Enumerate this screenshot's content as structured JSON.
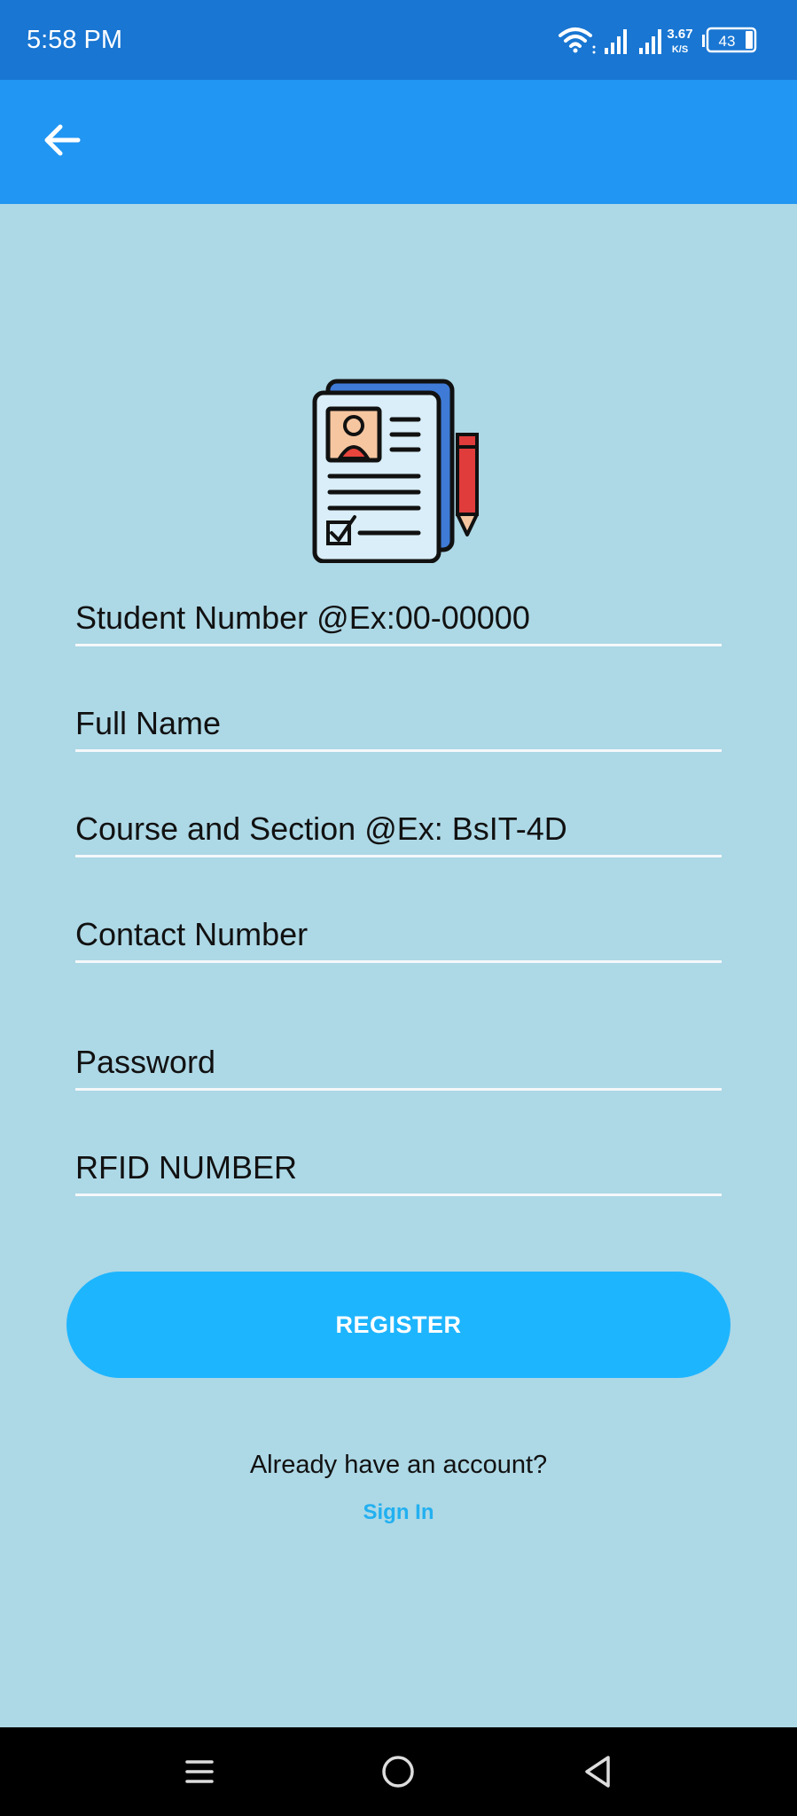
{
  "status_bar": {
    "time": "5:58 PM",
    "network_speed_value": "3.67",
    "network_speed_unit": "K/S",
    "battery": "43",
    "icons": [
      "wifi-icon",
      "signal-icon",
      "signal-icon",
      "battery-icon"
    ]
  },
  "app_bar": {
    "back_icon": "arrow-left-icon"
  },
  "illustration": {
    "icon": "registration-form-with-pencil-icon"
  },
  "form": {
    "fields": [
      {
        "name": "student-number",
        "placeholder": "Student Number @Ex:00-00000",
        "value": ""
      },
      {
        "name": "full-name",
        "placeholder": "Full Name",
        "value": ""
      },
      {
        "name": "course-section",
        "placeholder": "Course and Section @Ex: BsIT-4D",
        "value": ""
      },
      {
        "name": "contact-number",
        "placeholder": "Contact Number",
        "value": ""
      },
      {
        "name": "password",
        "placeholder": "Password",
        "value": ""
      },
      {
        "name": "rfid-number",
        "placeholder": "RFID NUMBER",
        "value": ""
      }
    ],
    "register_label": "REGISTER"
  },
  "footer": {
    "already_text": "Already have an account?",
    "signin_label": "Sign In"
  },
  "nav_bar": {
    "icons": [
      "menu-icon",
      "home-icon",
      "back-triangle-icon"
    ]
  },
  "colors": {
    "status_bar": "#1976D2",
    "app_bar": "#2196F3",
    "background": "#ADD8E6",
    "button": "#1EB5FF",
    "link": "#22B0F0"
  }
}
